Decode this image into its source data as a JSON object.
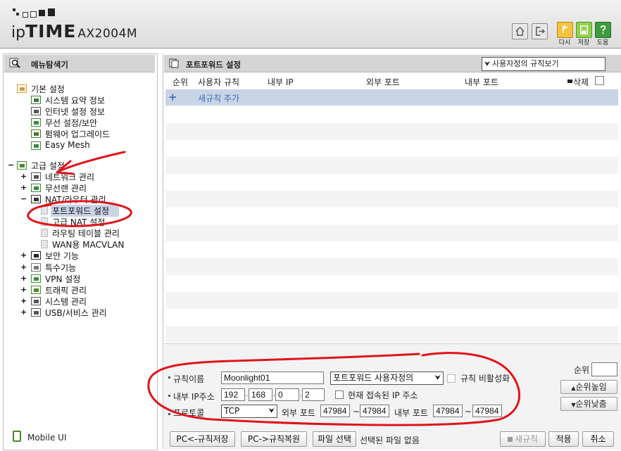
{
  "header": {
    "brand_ip": "ip",
    "brand_time": "TIME",
    "model": "AX2004M",
    "buttons": [
      {
        "icon": "home-icon"
      },
      {
        "icon": "logout-icon"
      },
      {
        "icon": "refresh-icon",
        "label": "다시"
      },
      {
        "icon": "save-icon",
        "label": "저장"
      },
      {
        "icon": "help-icon",
        "label": "도움"
      }
    ]
  },
  "left": {
    "title": "메뉴탐색기",
    "tree": [
      {
        "label": "기본 설정",
        "level": 0,
        "expander": "",
        "icon": "basic-settings-icon"
      },
      {
        "label": "시스템 요약 정보",
        "level": 1,
        "expander": "",
        "icon": "bar-chart-icon"
      },
      {
        "label": "인터넷 설정 정보",
        "level": 1,
        "expander": "",
        "icon": "monitor-icon"
      },
      {
        "label": "무선 설정/보안",
        "level": 1,
        "expander": "",
        "icon": "wifi-icon"
      },
      {
        "label": "펌웨어 업그레이드",
        "level": 1,
        "expander": "",
        "icon": "upgrade-icon"
      },
      {
        "label": "Easy Mesh",
        "level": 1,
        "expander": "",
        "icon": "mesh-icon"
      },
      {
        "label": "고급 설정",
        "level": 0,
        "expander": "−",
        "icon": "advanced-settings-icon"
      },
      {
        "label": "네트워크 관리",
        "level": 1,
        "expander": "+",
        "icon": "network-icon"
      },
      {
        "label": "무선랜 관리",
        "level": 1,
        "expander": "+",
        "icon": "wireless-icon"
      },
      {
        "label": "NAT/라우터 관리",
        "level": 1,
        "expander": "−",
        "icon": "router-icon"
      },
      {
        "label": "포트포워드 설정",
        "level": 2,
        "expander": "",
        "icon": "page-icon",
        "selected": true
      },
      {
        "label": "고급 NAT 설정",
        "level": 2,
        "expander": "",
        "icon": "page-icon"
      },
      {
        "label": "라우팅 테이블 관리",
        "level": 2,
        "expander": "",
        "icon": "page-icon"
      },
      {
        "label": "WAN용 MACVLAN",
        "level": 2,
        "expander": "",
        "icon": "page-icon"
      },
      {
        "label": "보안 기능",
        "level": 1,
        "expander": "+",
        "icon": "lock-icon"
      },
      {
        "label": "특수기능",
        "level": 1,
        "expander": "+",
        "icon": "special-icon"
      },
      {
        "label": "VPN 설정",
        "level": 1,
        "expander": "+",
        "icon": "vpn-icon"
      },
      {
        "label": "트래픽 관리",
        "level": 1,
        "expander": "+",
        "icon": "traffic-icon"
      },
      {
        "label": "시스템 관리",
        "level": 1,
        "expander": "+",
        "icon": "system-icon"
      },
      {
        "label": "USB/서비스 관리",
        "level": 1,
        "expander": "+",
        "icon": "usb-icon"
      }
    ],
    "mobile_ui": "Mobile UI"
  },
  "right": {
    "title": "포트포워드 설정",
    "view_select": "사용자정의 규칙보기",
    "columns": [
      "순위",
      "사용자 규칙",
      "내부 IP",
      "외부 포트",
      "내부 포트",
      "삭제"
    ],
    "add_rule": "새규칙 추가"
  },
  "form": {
    "rule_name_label": "규칙이름",
    "rule_name_value": "Moonlight01",
    "rule_type": "포트포워드 사용자정의",
    "disable_rule_label": "규칙 비활성화",
    "internal_ip_label": "내부 IP주소",
    "ip_octets": [
      "192",
      "168",
      "0",
      "2"
    ],
    "current_ip_label": "현재 접속된 IP 주소",
    "protocol_label": "프로토콜",
    "protocol_value": "TCP",
    "external_port_label": "외부 포트",
    "ext_port_from": "47984",
    "ext_port_to": "47984",
    "internal_port_label": "내부 포트",
    "int_port_from": "47984",
    "int_port_to": "47984",
    "tilde": "~",
    "priority_label": "순위",
    "priority_up": "순위높임",
    "priority_down": "순위낮춤"
  },
  "footer_buttons": {
    "pc_save": "PC<-규칙저장",
    "pc_restore": "PC->규칙복원",
    "file_select": "파일 선택",
    "no_file": "선택된 파일 없음",
    "new_rule": "새규칙",
    "apply": "적용",
    "cancel": "취소"
  },
  "colors": {
    "annotation_red": "#e0141b",
    "selected_bg": "#c9d4e6",
    "link_blue": "#3a6fb7"
  }
}
